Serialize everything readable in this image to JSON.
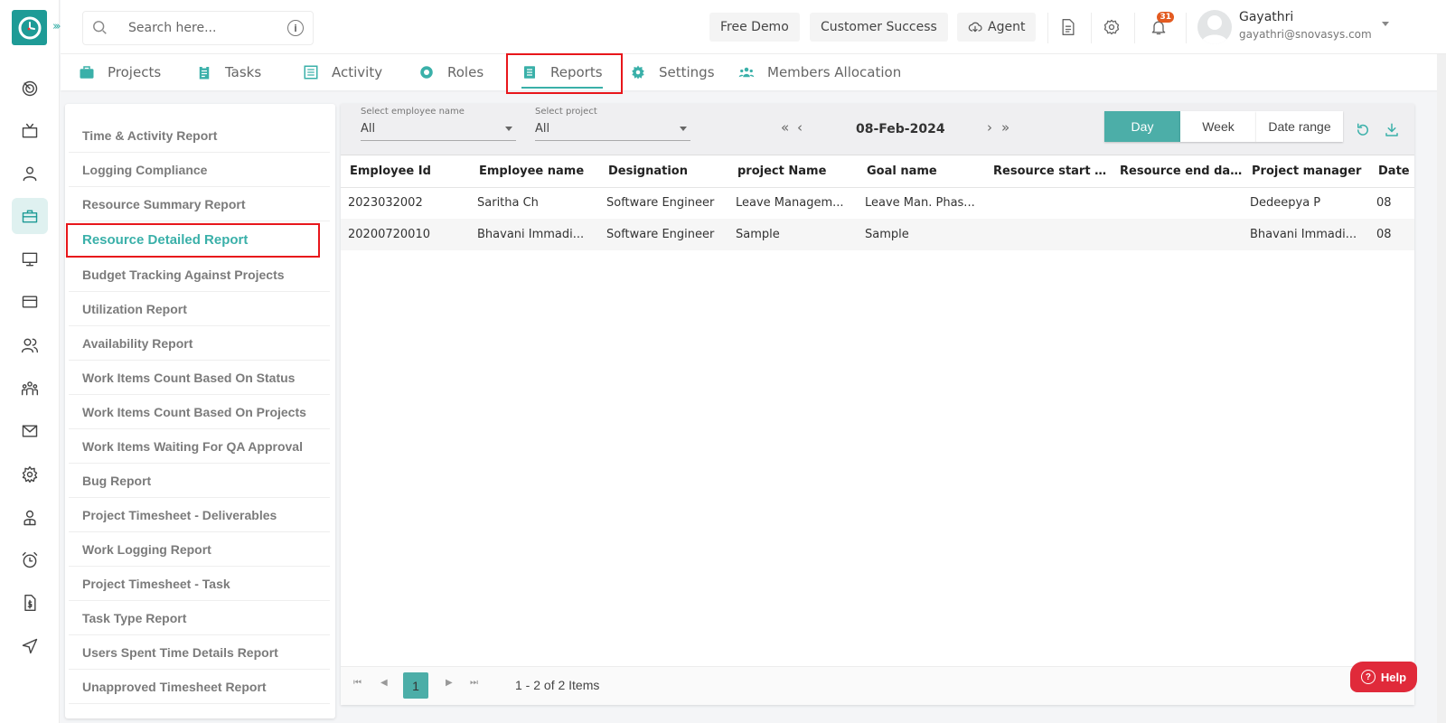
{
  "topbar": {
    "search_placeholder": "Search here...",
    "buttons": {
      "free_demo": "Free Demo",
      "customer_success": "Customer Success",
      "agent": "Agent"
    },
    "notification_count": "31",
    "user": {
      "name": "Gayathri",
      "email": "gayathri@snovasys.com"
    }
  },
  "nav_tabs": [
    {
      "label": "Projects",
      "icon": "briefcase-icon"
    },
    {
      "label": "Tasks",
      "icon": "clipboard-icon"
    },
    {
      "label": "Activity",
      "icon": "list-icon"
    },
    {
      "label": "Roles",
      "icon": "gear-icon"
    },
    {
      "label": "Reports",
      "icon": "document-icon",
      "active": true
    },
    {
      "label": "Settings",
      "icon": "cog-icon"
    },
    {
      "label": "Members Allocation",
      "icon": "users-icon"
    }
  ],
  "rail_icons": [
    "dashboard-icon",
    "tv-icon",
    "user-icon",
    "briefcase-icon",
    "monitor-icon",
    "card-icon",
    "users-icon",
    "team-icon",
    "mail-icon",
    "settings-icon",
    "profile-icon",
    "alarm-icon",
    "invoice-icon",
    "send-icon"
  ],
  "reports": {
    "active": "Resource Detailed Report",
    "items": [
      "Time & Activity Report",
      "Logging Compliance",
      "Resource Summary Report",
      "Resource Detailed Report",
      "Budget Tracking Against Projects",
      "Utilization Report",
      "Availability Report",
      "Work Items Count Based On Status",
      "Work Items Count Based On Projects",
      "Work Items Waiting For QA Approval",
      "Bug Report",
      "Project Timesheet - Deliverables",
      "Work Logging Report",
      "Project Timesheet - Task",
      "Task Type Report",
      "Users Spent Time Details Report",
      "Unapproved Timesheet Report"
    ]
  },
  "filters": {
    "employee": {
      "label": "Select employee name",
      "value": "All"
    },
    "project": {
      "label": "Select project",
      "value": "All"
    },
    "date": "08-Feb-2024",
    "modes": [
      "Day",
      "Week",
      "Date range"
    ],
    "active_mode": "Day"
  },
  "table": {
    "columns": [
      "Employee Id",
      "Employee name",
      "Designation",
      "project Name",
      "Goal name",
      "Resource start d...",
      "Resource end date",
      "Project manager",
      "Date"
    ],
    "rows": [
      [
        "2023032002",
        "Saritha Ch",
        "Software Engineer",
        "Leave Managem...",
        "Leave Man. Phas...",
        "",
        "",
        "Dedeepya P",
        "08"
      ],
      [
        "20200720010",
        "Bhavani Immadi...",
        "Software Engineer",
        "Sample",
        "Sample",
        "",
        "",
        "Bhavani Immadi...",
        "08"
      ]
    ]
  },
  "pagination": {
    "current_page": "1",
    "info": "1 - 2 of 2 Items"
  },
  "help_label": "Help",
  "colors": {
    "accent": "#3ab0a9",
    "logo": "#1e9b96",
    "highlight": "#e8161b",
    "help": "#e02a3a",
    "badge": "#e35b21"
  }
}
